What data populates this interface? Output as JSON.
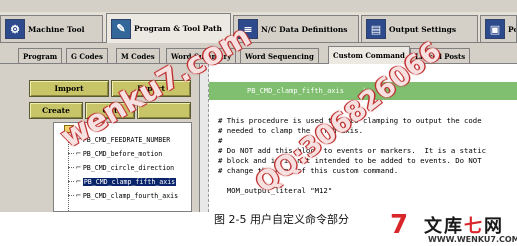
{
  "main_tabs": [
    {
      "label": "Machine Tool",
      "icon": "machine-tool-icon",
      "active": false
    },
    {
      "label": "Program & Tool Path",
      "icon": "program-tool-path-icon",
      "active": true
    },
    {
      "label": "N/C Data Definitions",
      "icon": "nc-data-definitions-icon",
      "active": false
    },
    {
      "label": "Output Settings",
      "icon": "output-settings-icon",
      "active": false
    },
    {
      "label": "Po",
      "icon": "post-icon",
      "active": false
    }
  ],
  "sub_tabs": [
    {
      "label": "Program",
      "active": false
    },
    {
      "label": "G Codes",
      "active": false
    },
    {
      "label": "M Codes",
      "active": false
    },
    {
      "label": "Word Summary",
      "active": false
    },
    {
      "label": "Word Sequencing",
      "active": false
    },
    {
      "label": "Custom Command",
      "active": true
    },
    {
      "label": "Linked Posts",
      "active": false
    }
  ],
  "buttons": {
    "import": "Import",
    "export": "Export",
    "create": "Create",
    "cut": "Cut"
  },
  "tree_items": [
    {
      "label": "PB_CMD_FEEDRATE_NUMBER",
      "selected": false
    },
    {
      "label": "PB_CMD_before_motion",
      "selected": false
    },
    {
      "label": "PB_CMD_circle_direction",
      "selected": false
    },
    {
      "label": "PB_CMD_clamp_fifth_axis",
      "selected": true
    },
    {
      "label": "PB_CMD_clamp_fourth_axis",
      "selected": false
    }
  ],
  "editor": {
    "command_name": "PB_CMD_clamp_fifth_axis",
    "caret": "|",
    "code_lines": [
      "# This procedure is used to auto clamping to output the code",
      "# needed to clamp the fifth axis.",
      "#",
      "# Do NOT add this block to events or markers.  It is a static",
      "# block and it is not intended to be added to events. Do NOT",
      "# change the name of this custom command.",
      "",
      "  MOM_output_literal \"M12\""
    ]
  },
  "caption": "图 2-5  用户自定义命令部分",
  "logo": {
    "mark": "7",
    "text_a": "文库",
    "text_b": "七",
    "text_c": "网",
    "url": "WWW.WENKU7.COM"
  },
  "watermarks": [
    "wenku7.com",
    "QQ:306826066"
  ],
  "colors": {
    "accent_header": "#7fbf6f",
    "button": "#c8c468",
    "selection": "#0a246a",
    "logo_red": "#d9262b"
  }
}
